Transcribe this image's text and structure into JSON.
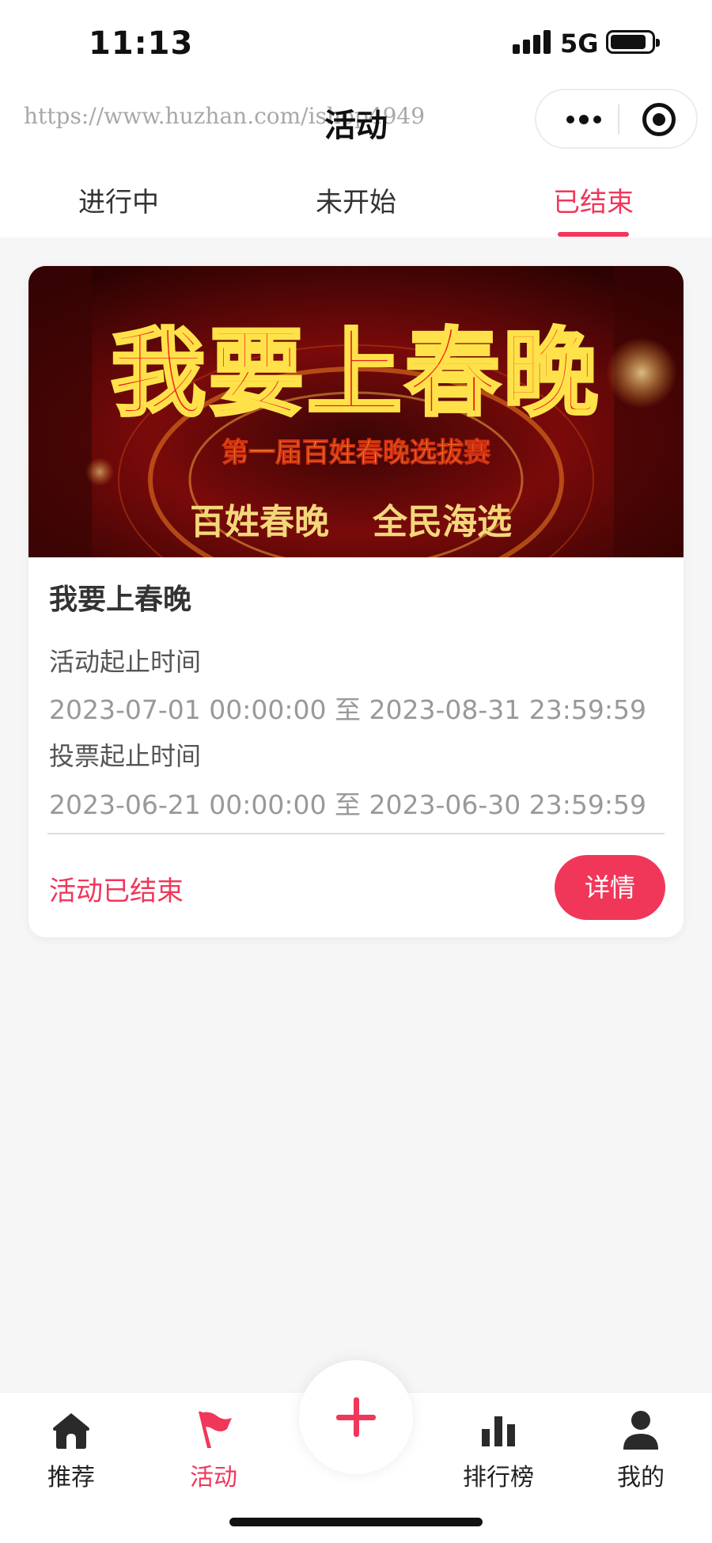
{
  "status_bar": {
    "time": "11:13",
    "network": "5G"
  },
  "nav": {
    "title": "活动",
    "watermark": "https://www.huzhan.com/ishop4949"
  },
  "tabs": [
    {
      "label": "进行中",
      "active": false
    },
    {
      "label": "未开始",
      "active": false
    },
    {
      "label": "已结束",
      "active": true
    }
  ],
  "activity": {
    "banner": {
      "headline": "我要上春晚",
      "subtitle": "第一届百姓春晚选拔赛",
      "slogan_left": "百姓春晚",
      "slogan_right": "全民海选"
    },
    "title": "我要上春晚",
    "activity_time_label": "活动起止时间",
    "activity_time_range": "2023-07-01 00:00:00 至 2023-08-31 23:59:59",
    "vote_time_label": "投票起止时间",
    "vote_time_range": "2023-06-21 00:00:00 至 2023-06-30 23:59:59",
    "status": "活动已结束",
    "detail_button": "详情"
  },
  "tabbar": [
    {
      "label": "推荐",
      "icon": "home-icon",
      "active": false
    },
    {
      "label": "活动",
      "icon": "flag-icon",
      "active": true
    },
    {
      "label": "排行榜",
      "icon": "bar-chart-icon",
      "active": false
    },
    {
      "label": "我的",
      "icon": "user-icon",
      "active": false
    }
  ],
  "colors": {
    "accent": "#f0375a",
    "background": "#f6f6f7"
  }
}
